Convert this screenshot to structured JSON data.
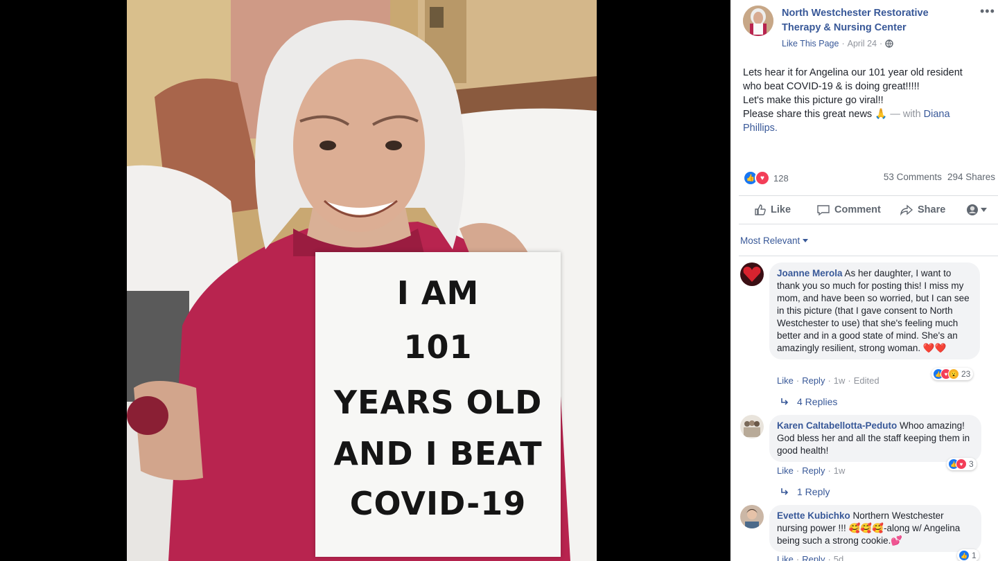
{
  "photo": {
    "sign_lines": [
      "I AM",
      "101",
      "YEARS OLD",
      "AND I BEAT",
      "COVID-19"
    ]
  },
  "post": {
    "page_name": "North Westchester Restorative Therapy & Nursing Center",
    "page_name_line1": "North Westchester Restorative",
    "page_name_line2": "Therapy & Nursing Center",
    "like_page": "Like This Page",
    "date": "April 24",
    "audience_icon": "globe-icon",
    "text_lines": [
      "Lets hear it for Angelina our 101 year old resident",
      "who beat COVID-19 & is doing great!!!!!",
      "Let's make this picture go viral!!",
      "Please share this great news"
    ],
    "emoji": "🙏",
    "with_text": "— with",
    "tagged_name": "Diana Phillips.",
    "tagged_line1": "Diana",
    "tagged_line2": "Phillips."
  },
  "stats": {
    "reaction_count": "128",
    "comments": "53 Comments",
    "shares": "294 Shares"
  },
  "actions": {
    "like": "Like",
    "comment": "Comment",
    "share": "Share"
  },
  "sort": {
    "label": "Most Relevant"
  },
  "comments": [
    {
      "author": "Joanne Merola",
      "text": "As her daughter, I want to thank you so much for posting this! I miss my mom, and have been so worried, but I can see in this picture (that I gave consent to North Westchester to use) that she's feeling much better and in a good state of mind. She's an amazingly resilient, strong woman. ❤️❤️",
      "like": "Like",
      "reply": "Reply",
      "time": "1w",
      "edited": "Edited",
      "reactions": "23",
      "replies": "4 Replies"
    },
    {
      "author": "Karen Caltabellotta-Peduto",
      "text": "Whoo amazing! God bless her and all the staff keeping them in good health!",
      "like": "Like",
      "reply": "Reply",
      "time": "1w",
      "reactions": "3",
      "replies": "1 Reply"
    },
    {
      "author": "Evette Kubichko",
      "text": "Northern Westchester nursing power !!! 🥰🥰🥰-along w/ Angelina being such a strong cookie.💕",
      "like": "Like",
      "reply": "Reply",
      "time": "5d",
      "reactions": "1"
    }
  ],
  "colors": {
    "link": "#385898",
    "like_blue": "#1877f2",
    "love_red": "#f33e58",
    "sweater": "#b8244f"
  }
}
